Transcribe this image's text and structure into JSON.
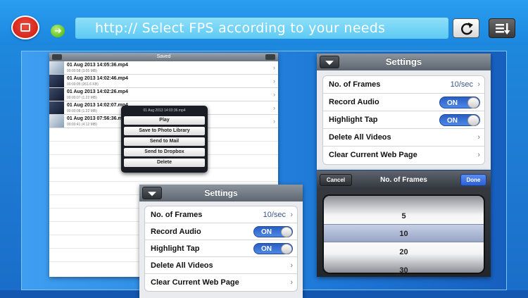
{
  "toolbar": {
    "url_text": "http:// Select FPS according to your needs",
    "go_icon": "➜"
  },
  "saved_list": {
    "title": "Saved",
    "rows": [
      {
        "title": "01 Aug 2013 14:05:36.mp4",
        "sub": "00:00:58 (3.05 MB)"
      },
      {
        "title": "01 Aug 2013 14:02:46.mp4",
        "sub": "00:00:05 (261.6 KB)"
      },
      {
        "title": "01 Aug 2013 14:02:26.mp4",
        "sub": "00:00:07 (1.22 MB)"
      },
      {
        "title": "01 Aug 2013 14:02:07.mp4",
        "sub": "00:00:08 (1.22 MB)"
      },
      {
        "title": "01 Aug 2013 07:56:36.mp4",
        "sub": "00:00:41 (4.12 MB)"
      }
    ]
  },
  "popover": {
    "title": "01 Aug 2013 14:03:36.mp4",
    "actions": [
      "Play",
      "Save to Photo Library",
      "Send to Mail",
      "Send to Dropbox",
      "Delete"
    ]
  },
  "settings": {
    "title": "Settings",
    "frames_label": "No. of Frames",
    "frames_value": "10/sec",
    "record_audio_label": "Record Audio",
    "highlight_tap_label": "Highlight Tap",
    "toggle_on": "ON",
    "delete_all_label": "Delete All Videos",
    "clear_page_label": "Clear Current Web Page"
  },
  "picker": {
    "title": "No. of Frames",
    "cancel": "Cancel",
    "done": "Done",
    "options": [
      "5",
      "10",
      "20",
      "30"
    ],
    "selected": "10"
  }
}
